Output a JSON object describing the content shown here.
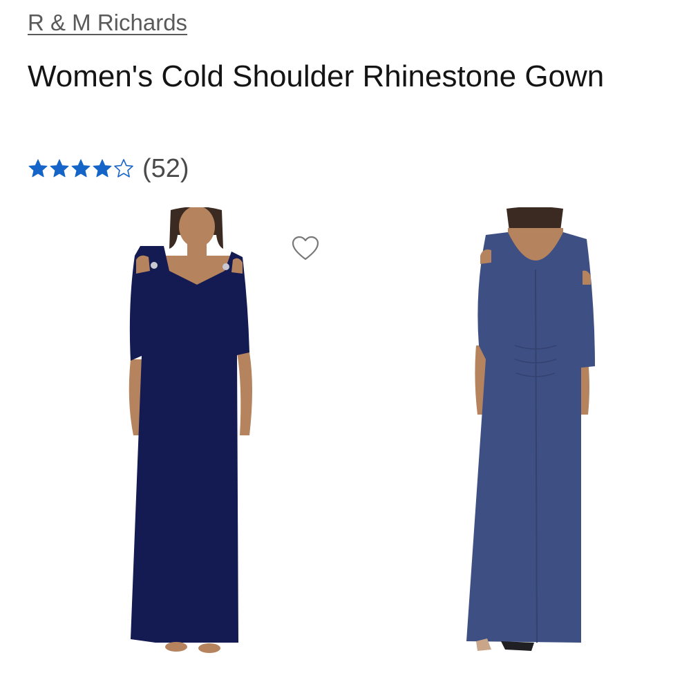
{
  "product": {
    "brand": "R & M Richards",
    "title": "Women's Cold Shoulder Rhinestone Gown",
    "rating": {
      "stars_filled": 4,
      "stars_total": 5,
      "review_count": "(52)"
    }
  },
  "colors": {
    "star": "#1565c8",
    "gown_front": "#141a52",
    "gown_back": "#3e4f84",
    "skin": "#b5835e",
    "hair": "#3b2a22"
  },
  "icons": {
    "favorite": "heart-outline-icon",
    "star_filled": "star-filled-icon",
    "star_empty": "star-outline-icon"
  }
}
